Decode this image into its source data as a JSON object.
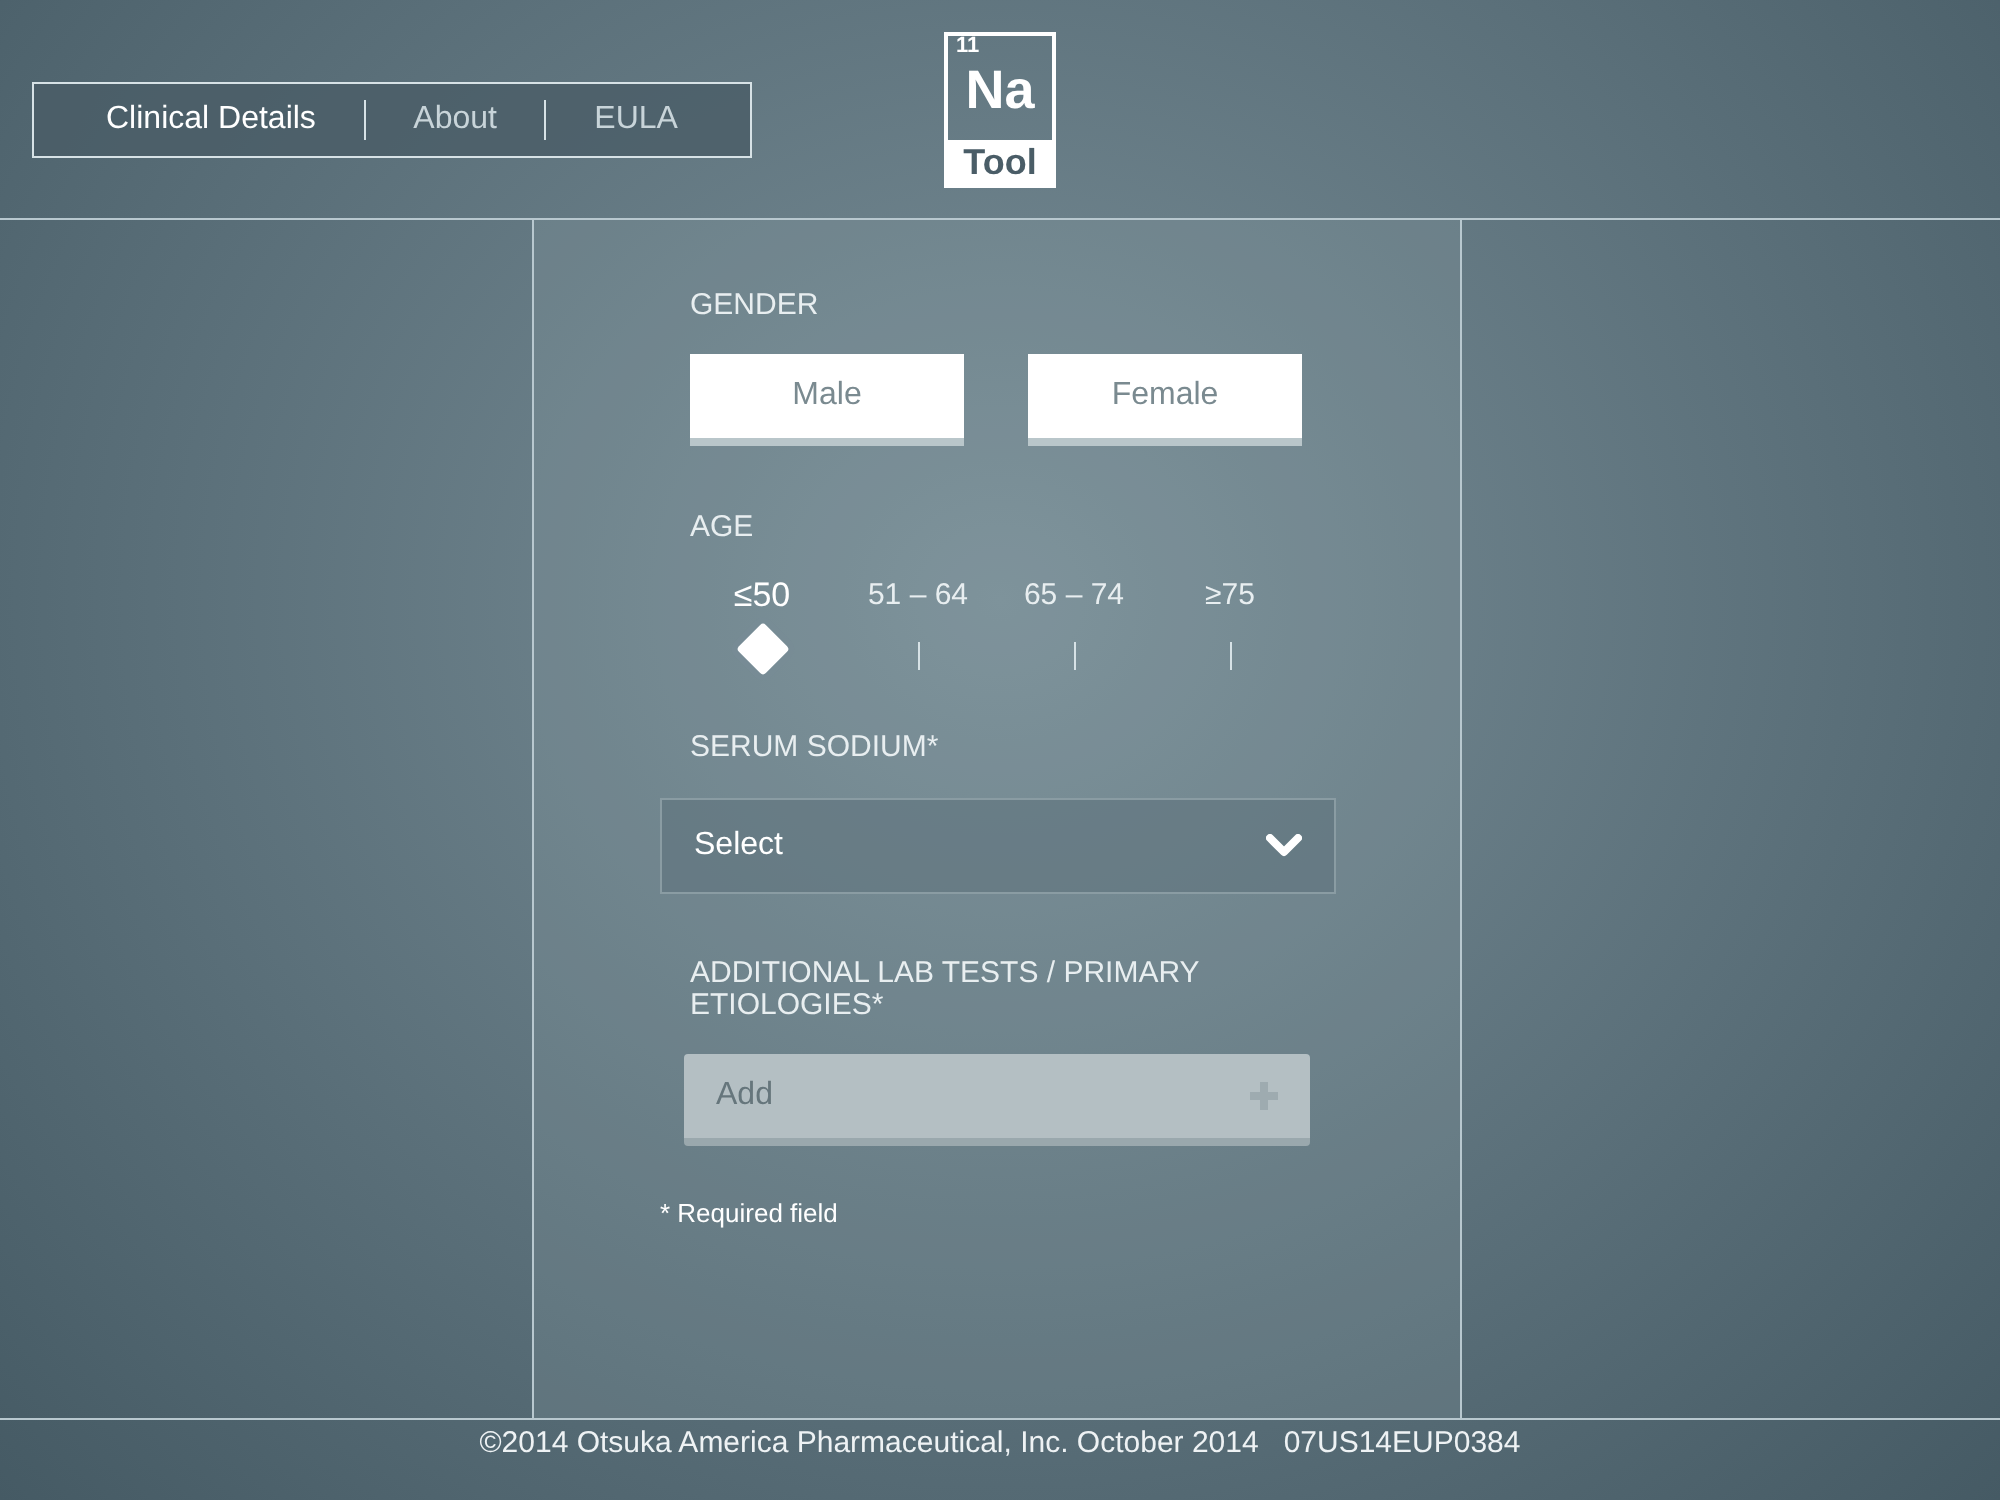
{
  "nav": {
    "tabs": [
      {
        "label": "Clinical Details",
        "selected": true
      },
      {
        "label": "About",
        "selected": false
      },
      {
        "label": "EULA",
        "selected": false
      }
    ]
  },
  "logo": {
    "number": "11",
    "symbol": "Na",
    "word": "Tool"
  },
  "form": {
    "gender": {
      "label": "GENDER",
      "options": [
        {
          "label": "Male",
          "selected": false
        },
        {
          "label": "Female",
          "selected": false
        }
      ]
    },
    "age": {
      "label": "AGE",
      "options": [
        {
          "label": "≤50",
          "selected": true
        },
        {
          "label": "51 – 64",
          "selected": false
        },
        {
          "label": "65 – 74",
          "selected": false
        },
        {
          "label": "≥75",
          "selected": false
        }
      ]
    },
    "serum_sodium": {
      "label": "SERUM SODIUM*",
      "value": "Select"
    },
    "lab_tests": {
      "label": "ADDITIONAL LAB TESTS / PRIMARY ETIOLOGIES*",
      "placeholder": "Add"
    },
    "note": "* Required field"
  },
  "footer": {
    "text": "©2014 Otsuka America Pharmaceutical, Inc. October 2014   07US14EUP0384"
  }
}
